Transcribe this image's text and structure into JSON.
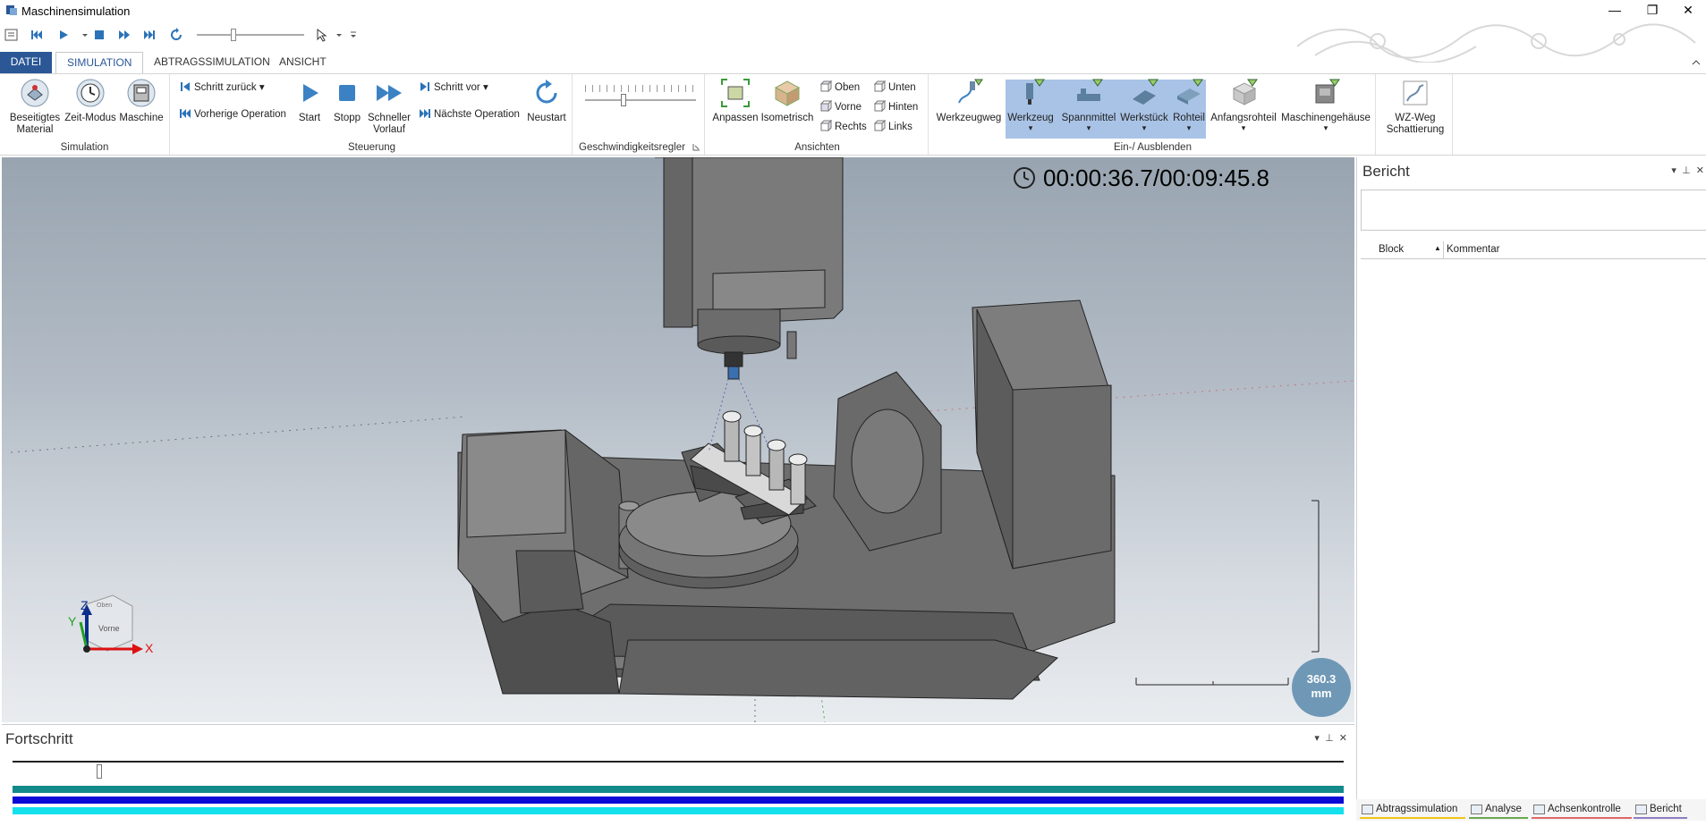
{
  "window": {
    "title": "Maschinensimulation",
    "minimize": "—",
    "restore": "❐",
    "close": "✕"
  },
  "tabs": [
    {
      "label": "DATEI"
    },
    {
      "label": "SIMULATION"
    },
    {
      "label": "ABTRAGSSIMULATION"
    },
    {
      "label": "ANSICHT"
    }
  ],
  "ribbon": {
    "simulation": {
      "label": "Simulation",
      "removed_material": "Beseitigtes\nMaterial",
      "time_mode": "Zeit-Modus",
      "machine": "Maschine"
    },
    "steuerung": {
      "label": "Steuerung",
      "step_back": "Schritt zurück",
      "prev_op": "Vorherige Operation",
      "start": "Start",
      "stop": "Stopp",
      "faster": "Schneller\nVorlauf",
      "step_forward": "Schritt vor",
      "next_op": "Nächste Operation",
      "restart": "Neustart"
    },
    "speed": {
      "label": "Geschwindigkeitsregler"
    },
    "views": {
      "label": "Ansichten",
      "fit": "Anpassen",
      "iso": "Isometrisch",
      "top": "Oben",
      "front": "Vorne",
      "right": "Rechts",
      "bottom": "Unten",
      "back": "Hinten",
      "left": "Links"
    },
    "visibility": {
      "label": "Ein-/ Ausblenden",
      "toolpath": "Werkzeugweg",
      "tool": "Werkzeug",
      "fixture": "Spannmittel",
      "workpiece": "Werkstück",
      "blank": "Rohteil",
      "initial_blank": "Anfangsrohteil",
      "machine_housing": "Maschinengehäuse"
    },
    "shading": {
      "label": "WZ-Weg\nSchattierung"
    }
  },
  "viewport": {
    "timer": "00:00:36.7/00:09:45.8",
    "scale": "360.3\nmm",
    "axis_x": "X",
    "axis_y": "Y",
    "axis_z": "Z",
    "cube_front": "Vorne",
    "cube_top": "Oben"
  },
  "report": {
    "title": "Bericht",
    "col_block": "Block",
    "col_comment": "Kommentar"
  },
  "bottom_tabs": [
    {
      "label": "Abtragssimulation",
      "color": "#f0c419"
    },
    {
      "label": "Analyse",
      "color": "#6aa84f"
    },
    {
      "label": "Achsenkontrolle",
      "color": "#e06666"
    },
    {
      "label": "Bericht",
      "color": "#8e7cc3"
    }
  ],
  "progress": {
    "title": "Fortschritt",
    "position": 0.063,
    "bar_colors": [
      "#138a8a",
      "#0b0bd6",
      "#14e0ee"
    ]
  },
  "colors": {
    "accent": "#2b5797",
    "highlight": "#a9c3e6",
    "scale_badge": "#6f98b6"
  }
}
